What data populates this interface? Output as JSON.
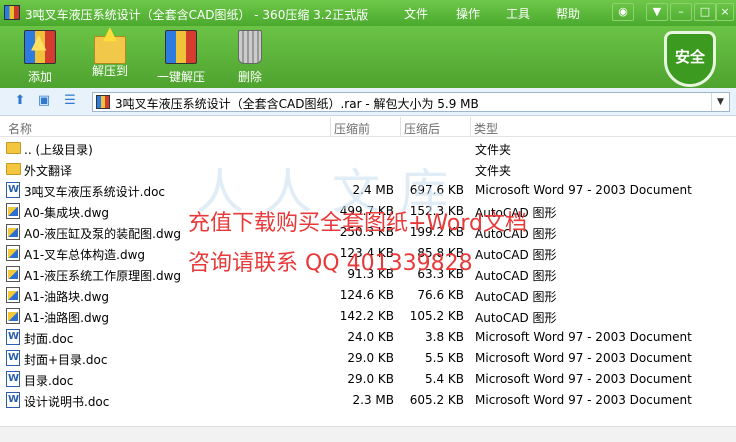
{
  "window": {
    "title": "3吨叉车液压系统设计（全套含CAD图纸） - 360压缩 3.2正式版",
    "menus": [
      "文件",
      "操作",
      "工具",
      "帮助"
    ]
  },
  "toolbar": {
    "add_label": "添加",
    "extract_to_label": "解压到",
    "one_click_label": "一键解压",
    "delete_label": "删除",
    "security_label": "安全"
  },
  "address": {
    "path": "3吨叉车液压系统设计（全套含CAD图纸）.rar - 解包大小为 5.9 MB"
  },
  "columns": {
    "name": "名称",
    "size": "压缩前",
    "compressed": "压缩后",
    "type": "类型"
  },
  "files": [
    {
      "icon": "folder",
      "name": ".. (上级目录)",
      "size": "",
      "compressed": "",
      "type": "文件夹"
    },
    {
      "icon": "folder",
      "name": "外文翻译",
      "size": "",
      "compressed": "",
      "type": "文件夹"
    },
    {
      "icon": "word",
      "name": "3吨叉车液压系统设计.doc",
      "size": "2.4 MB",
      "compressed": "697.6 KB",
      "type": "Microsoft Word 97 - 2003 Document"
    },
    {
      "icon": "cad",
      "name": "A0-集成块.dwg",
      "size": "499.7 KB",
      "compressed": "152.3 KB",
      "type": "AutoCAD 图形"
    },
    {
      "icon": "cad",
      "name": "A0-液压缸及泵的装配图.dwg",
      "size": "250.3 KB",
      "compressed": "199.2 KB",
      "type": "AutoCAD 图形"
    },
    {
      "icon": "cad",
      "name": "A1-叉车总体构造.dwg",
      "size": "123.4 KB",
      "compressed": "85.8 KB",
      "type": "AutoCAD 图形"
    },
    {
      "icon": "cad",
      "name": "A1-液压系统工作原理图.dwg",
      "size": "91.3 KB",
      "compressed": "63.3 KB",
      "type": "AutoCAD 图形"
    },
    {
      "icon": "cad",
      "name": "A1-油路块.dwg",
      "size": "124.6 KB",
      "compressed": "76.6 KB",
      "type": "AutoCAD 图形"
    },
    {
      "icon": "cad",
      "name": "A1-油路图.dwg",
      "size": "142.2 KB",
      "compressed": "105.2 KB",
      "type": "AutoCAD 图形"
    },
    {
      "icon": "word",
      "name": "封面.doc",
      "size": "24.0 KB",
      "compressed": "3.8 KB",
      "type": "Microsoft Word 97 - 2003 Document"
    },
    {
      "icon": "word",
      "name": "封面+目录.doc",
      "size": "29.0 KB",
      "compressed": "5.5 KB",
      "type": "Microsoft Word 97 - 2003 Document"
    },
    {
      "icon": "word",
      "name": "目录.doc",
      "size": "29.0 KB",
      "compressed": "5.4 KB",
      "type": "Microsoft Word 97 - 2003 Document"
    },
    {
      "icon": "word",
      "name": "设计说明书.doc",
      "size": "2.3 MB",
      "compressed": "605.2 KB",
      "type": "Microsoft Word 97 - 2003 Document"
    }
  ],
  "watermark": {
    "line1": "充值下载购买全套图纸+Word文档",
    "line2": "咨询请联系 QQ 401339828"
  }
}
